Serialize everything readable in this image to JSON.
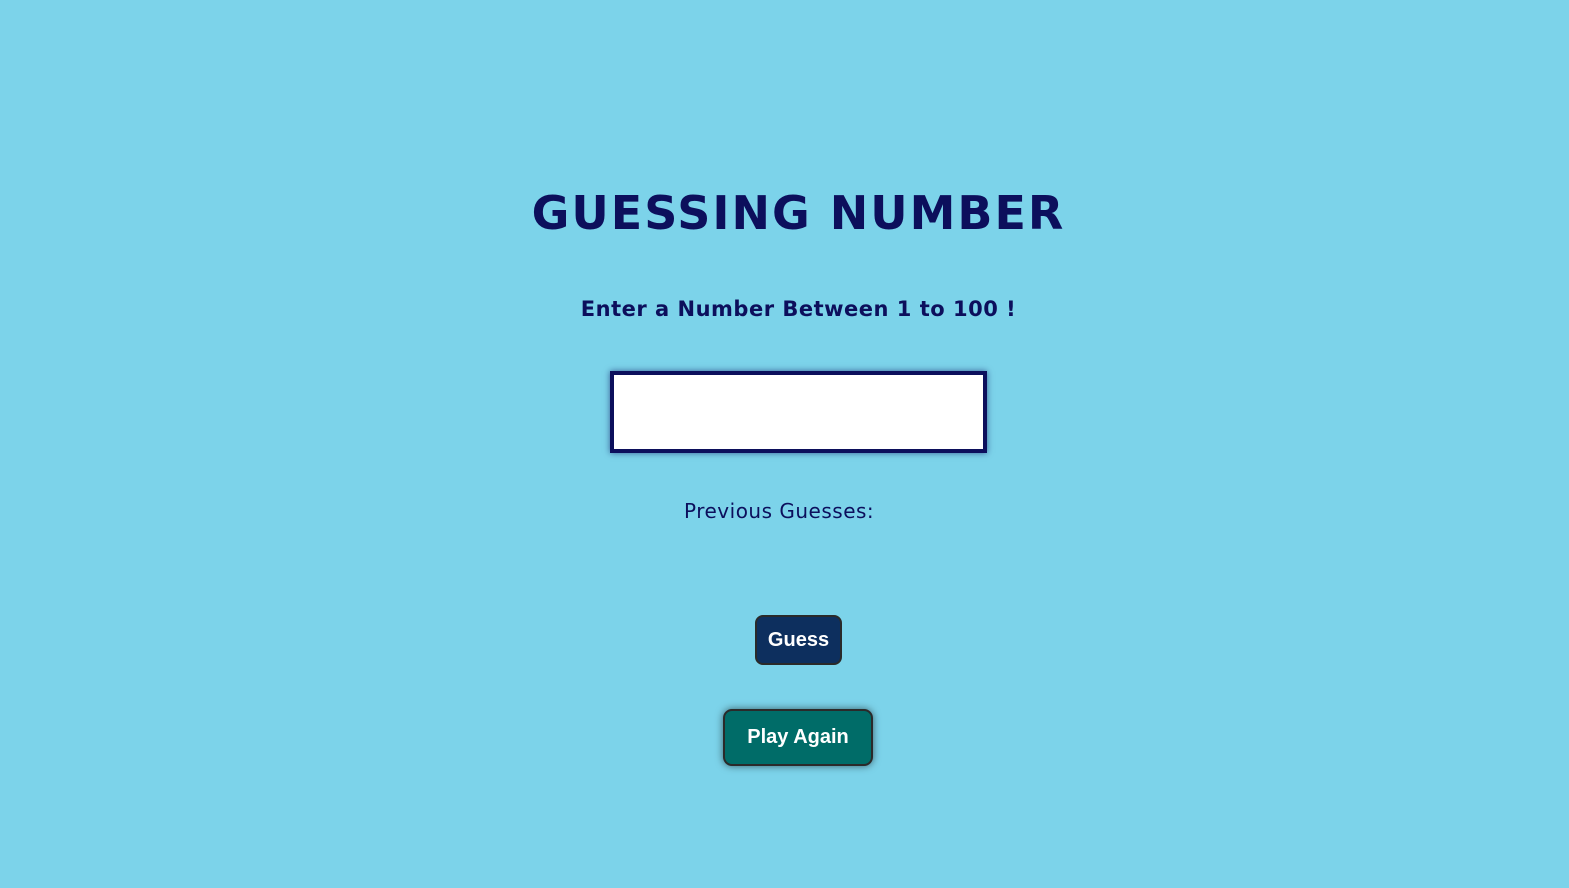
{
  "game": {
    "title": "GUESSING NUMBER",
    "instruction": "Enter a Number Between 1 to 100 !",
    "input": {
      "value": "",
      "placeholder": ""
    },
    "previous_guesses_label": "Previous Guesses:",
    "previous_guesses_values": "",
    "guess_button_label": "Guess",
    "play_again_button_label": "Play Again"
  },
  "colors": {
    "background": "#7cd3ea",
    "text": "#0c0f5c",
    "guess_button": "#0d2f5e",
    "play_again_button": "#006c68",
    "input_background": "#ffffff"
  }
}
